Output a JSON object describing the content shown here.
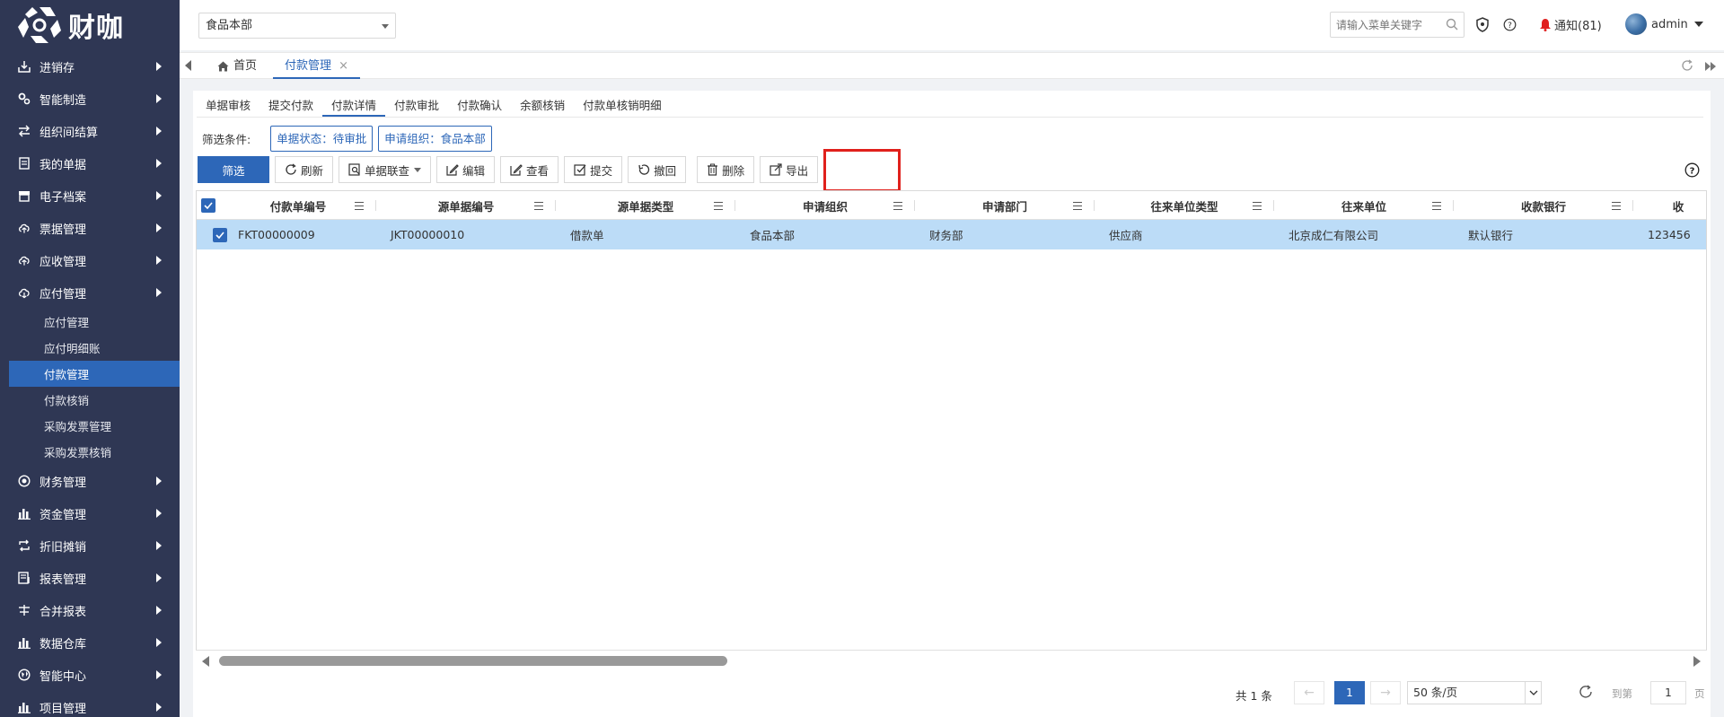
{
  "sidebar": {
    "logo_text": "财咖",
    "menu": [
      {
        "label": "进销存",
        "icon": "inbox-download-icon"
      },
      {
        "label": "智能制造",
        "icon": "gears-icon"
      },
      {
        "label": "组织间结算",
        "icon": "exchange-icon"
      },
      {
        "label": "我的单据",
        "icon": "document-icon"
      },
      {
        "label": "电子档案",
        "icon": "archive-icon"
      },
      {
        "label": "票据管理",
        "icon": "cloud-upload-icon"
      },
      {
        "label": "应收管理",
        "icon": "cloud-upload-icon"
      },
      {
        "label": "应付管理",
        "icon": "cloud-download-icon"
      }
    ],
    "sub_menu": [
      "应付管理",
      "应付明细账",
      "付款管理",
      "付款核销",
      "采购发票管理",
      "采购发票核销"
    ],
    "menu_after": [
      {
        "label": "财务管理",
        "icon": "circle-dot-icon"
      },
      {
        "label": "资金管理",
        "icon": "bar-chart-icon"
      },
      {
        "label": "折旧摊销",
        "icon": "repeat-icon"
      },
      {
        "label": "报表管理",
        "icon": "report-icon"
      },
      {
        "label": "合并报表",
        "icon": "merge-icon"
      },
      {
        "label": "数据仓库",
        "icon": "bar-chart-icon"
      },
      {
        "label": "智能中心",
        "icon": "globe-icon"
      },
      {
        "label": "项目管理",
        "icon": "bar-chart-icon"
      }
    ]
  },
  "topbar": {
    "org_value": "食品本部",
    "search_placeholder": "请输入菜单关键字",
    "notice_label": "通知(81)",
    "user_name": "admin"
  },
  "tabs": {
    "home": "首页",
    "active": "付款管理",
    "close": "×"
  },
  "subtabs": [
    "单据审核",
    "提交付款",
    "付款详情",
    "付款审批",
    "付款确认",
    "余额核销",
    "付款单核销明细"
  ],
  "filter": {
    "label": "筛选条件:",
    "chips": [
      "单据状态：待审批",
      "申请组织：食品本部"
    ]
  },
  "toolbar": {
    "filter": "筛选",
    "refresh": "刷新",
    "linked": "单据联查",
    "edit": "编辑",
    "view": "查看",
    "submit": "提交",
    "withdraw": "撤回",
    "delete": "删除",
    "export": "导出"
  },
  "grid": {
    "columns": [
      "付款单编号",
      "源单据编号",
      "源单据类型",
      "申请组织",
      "申请部门",
      "往来单位类型",
      "往来单位",
      "收款银行",
      "收"
    ],
    "rows": [
      [
        "FKT00000009",
        "JKT00000010",
        "借款单",
        "食品本部",
        "财务部",
        "供应商",
        "北京成仁有限公司",
        "默认银行",
        "123456"
      ]
    ]
  },
  "pager": {
    "total": "共 1 条",
    "prev": "←",
    "current": "1",
    "next": "→",
    "page_size": "50 条/页",
    "goto_label": "到第",
    "goto_value": "1",
    "page_unit": "页"
  },
  "colors": {
    "sidebar_bg": "#2f3754",
    "accent": "#2d67b8",
    "selected_row": "#bcdcf7",
    "highlight": "#e0201c",
    "bell": "#e02020"
  }
}
